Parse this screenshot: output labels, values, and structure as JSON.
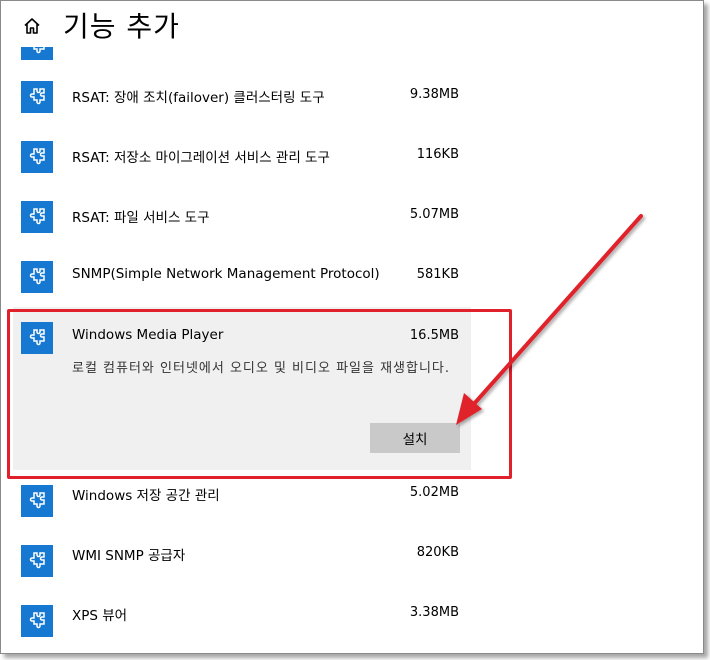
{
  "header": {
    "title": "기능 추가",
    "home_icon": "home-icon"
  },
  "items": [
    {
      "name": "RSAT: 장애 조치(failover) 클러스터링 도구",
      "size": "9.38MB"
    },
    {
      "name": "RSAT: 저장소 마이그레이션 서비스 관리 도구",
      "size": "116KB"
    },
    {
      "name": "RSAT: 파일 서비스 도구",
      "size": "5.07MB"
    },
    {
      "name": "SNMP(Simple Network Management Protocol)",
      "size": "581KB"
    },
    {
      "name": "Windows Media Player",
      "size": "16.5MB",
      "description": "로컬 컴퓨터와 인터넷에서 오디오 및 비디오 파일을 재생합니다.",
      "install_label": "설치",
      "expanded": true
    },
    {
      "name": "Windows 저장 공간 관리",
      "size": "5.02MB"
    },
    {
      "name": "WMI SNMP 공급자",
      "size": "820KB"
    },
    {
      "name": "XPS 뷰어",
      "size": "3.38MB"
    }
  ],
  "colors": {
    "tile": "#1778d2",
    "highlight": "#e0202a",
    "expanded_bg": "#f0f0f0",
    "button": "#c9c9c9"
  }
}
